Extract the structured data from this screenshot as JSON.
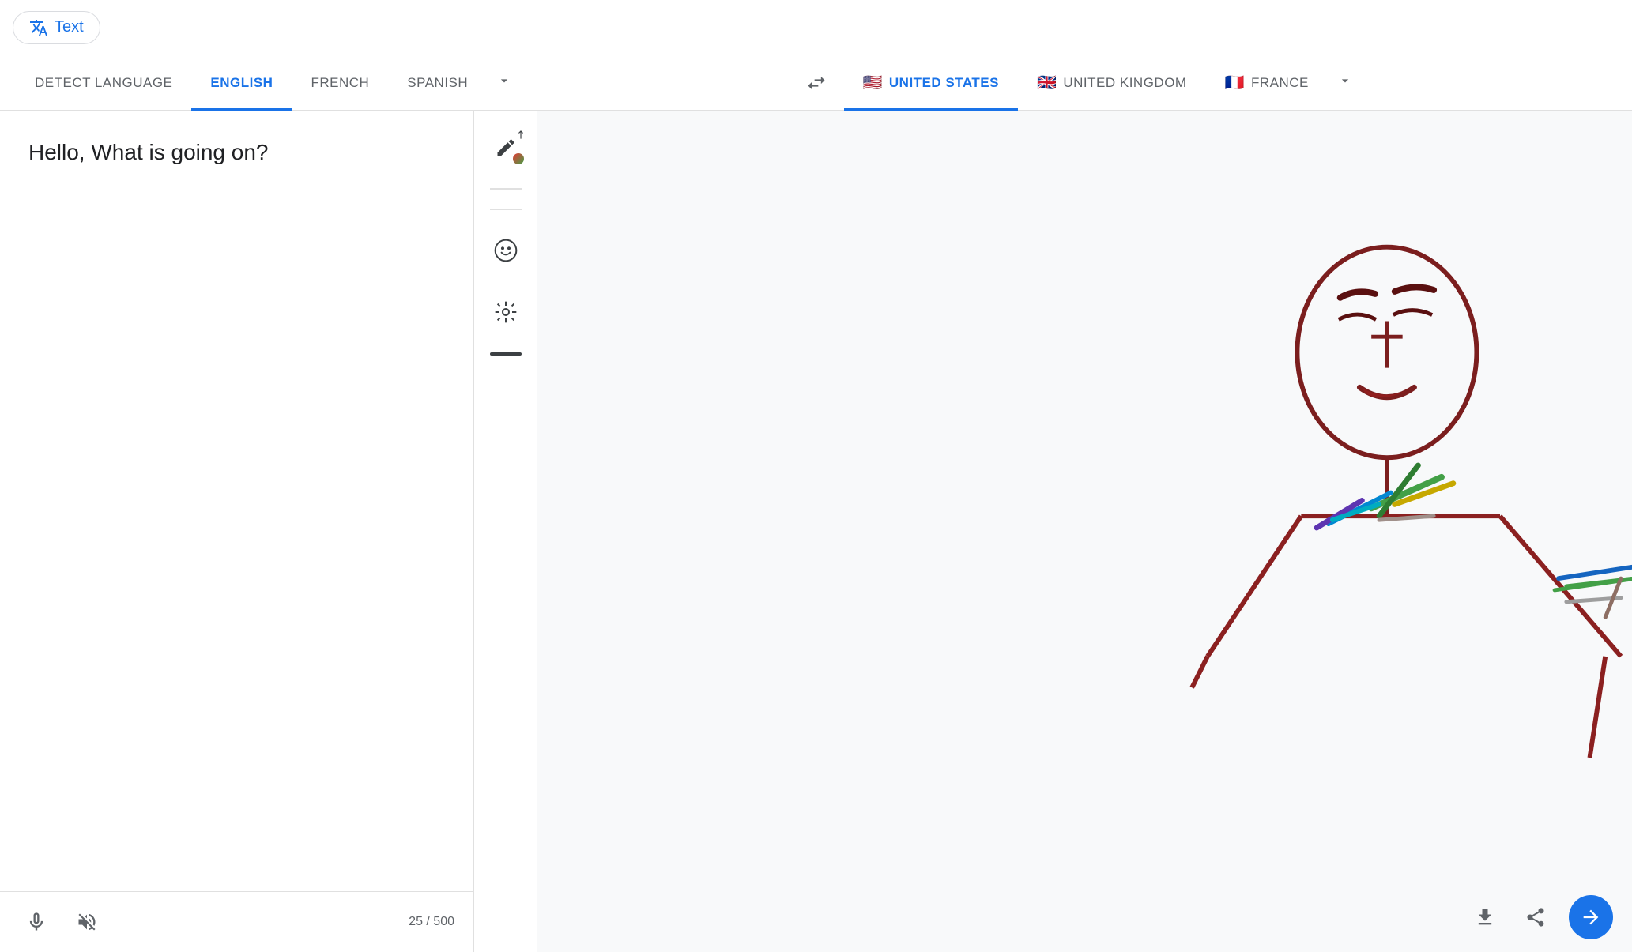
{
  "topbar": {
    "text_tab_label": "Text"
  },
  "langbar": {
    "source_langs": [
      {
        "label": "DETECT LANGUAGE",
        "active": false
      },
      {
        "label": "ENGLISH",
        "active": true
      },
      {
        "label": "FRENCH",
        "active": false
      },
      {
        "label": "SPANISH",
        "active": false
      }
    ],
    "target_langs": [
      {
        "label": "UNITED STATES",
        "active": true,
        "flag": "🇺🇸"
      },
      {
        "label": "UNITED KINGDOM",
        "active": false,
        "flag": "🇬🇧"
      },
      {
        "label": "FRANCE",
        "active": false,
        "flag": "🇫🇷"
      }
    ],
    "swap_label": "⇄"
  },
  "source": {
    "text": "Hello, What is going on?",
    "char_count": "25 / 500",
    "mic_label": "Microphone",
    "mute_label": "Mute"
  },
  "toolbar": {
    "pencil_label": "Pencil tool",
    "face_label": "Face selector",
    "expand_label": "Expand",
    "thickness_label": "Thickness"
  },
  "target": {
    "download_label": "Download",
    "share_label": "Share",
    "translate_label": "Translate"
  }
}
